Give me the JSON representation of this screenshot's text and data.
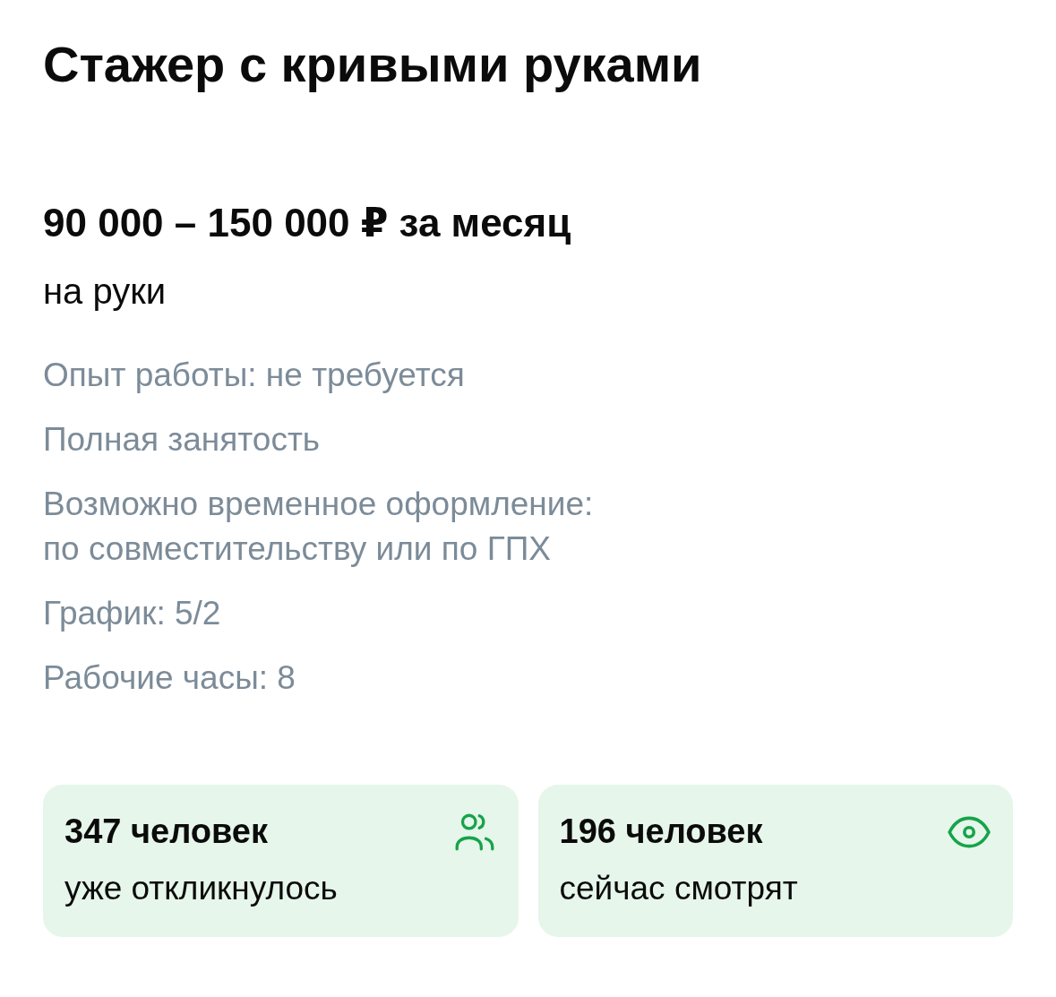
{
  "title": "Стажер с кривыми руками",
  "salary": {
    "amount": "90 000 – 150 000 ₽ за месяц",
    "note": "на руки"
  },
  "details": [
    {
      "lines": [
        "Опыт работы: не требуется"
      ]
    },
    {
      "lines": [
        "Полная занятость"
      ]
    },
    {
      "lines": [
        "Возможно временное оформление:",
        "по совместительству или по ГПХ"
      ]
    },
    {
      "lines": [
        "График: 5/2"
      ]
    },
    {
      "lines": [
        "Рабочие часы: 8"
      ]
    }
  ],
  "stats": [
    {
      "kind": "people",
      "count": "347 человек",
      "label": "уже откликнулось"
    },
    {
      "kind": "eye",
      "count": "196 человек",
      "label": "сейчас смотрят"
    }
  ]
}
